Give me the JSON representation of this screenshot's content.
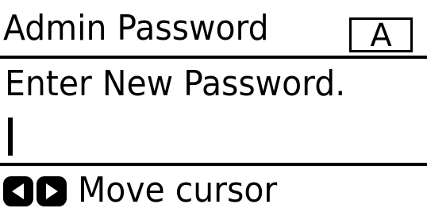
{
  "header": {
    "title": "Admin Password",
    "input_mode": "A"
  },
  "main": {
    "prompt": "Enter New Password.",
    "password_value": ""
  },
  "footer": {
    "hint_label": "Move cursor",
    "icons": [
      "left-arrow-button-icon",
      "right-arrow-button-icon"
    ]
  },
  "colors": {
    "background": "#ffffff",
    "foreground": "#000000"
  }
}
